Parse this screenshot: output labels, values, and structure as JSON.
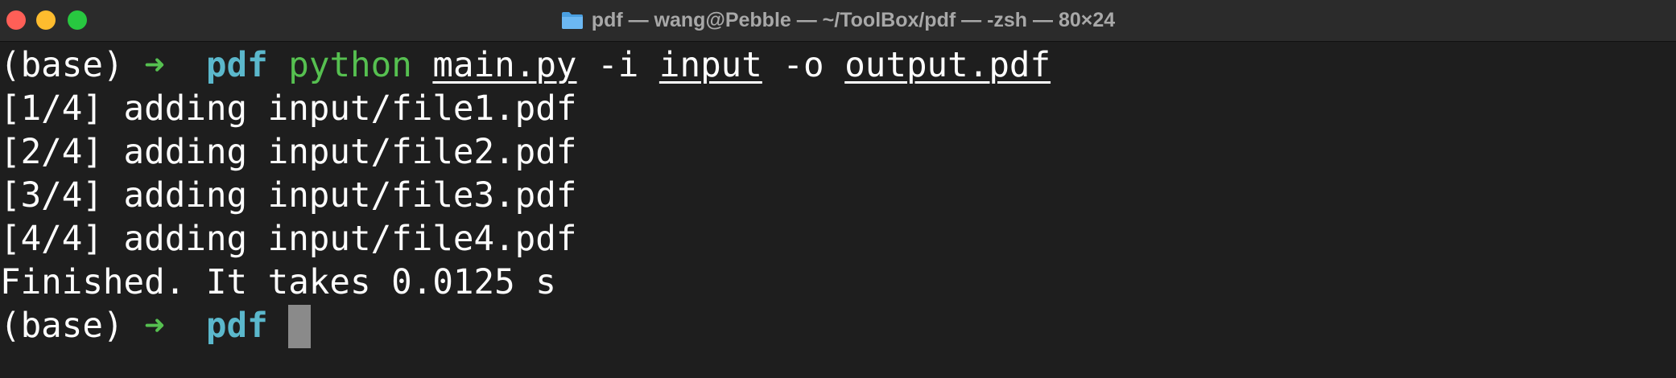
{
  "window": {
    "title": "pdf — wang@Pebble — ~/ToolBox/pdf — -zsh — 80×24",
    "icon": "folder-icon",
    "controls": {
      "close_color": "#ff5f57",
      "minimize_color": "#febc2e",
      "zoom_color": "#28c840"
    }
  },
  "terminal": {
    "prompt_env": "(base)",
    "prompt_arrow": "➜",
    "prompt_cwd": "pdf",
    "command": {
      "program": "python",
      "script": "main.py",
      "flag_in": "-i",
      "arg_in": "input",
      "flag_out": "-o",
      "arg_out": "output.pdf"
    },
    "output_lines": [
      "[1/4] adding input/file1.pdf",
      "[2/4] adding input/file2.pdf",
      "[3/4] adding input/file3.pdf",
      "[4/4] adding input/file4.pdf",
      "Finished. It takes 0.0125 s"
    ]
  },
  "colors": {
    "background": "#1e1e1e",
    "arrow": "#56c050",
    "cwd": "#5bb8cc",
    "command": "#56c050",
    "cursor": "#8a8a8a"
  }
}
